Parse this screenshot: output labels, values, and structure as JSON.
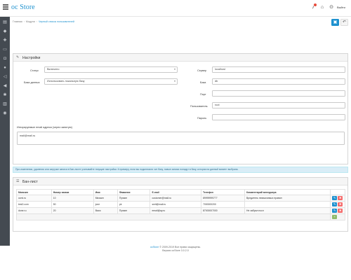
{
  "header": {
    "logo": "oc Store",
    "alert_icon": "bell-icon",
    "home_icon": "home-icon",
    "help_icon": "help-icon",
    "logout": "Выйти"
  },
  "sidebar": {
    "items": [
      "dashboard-icon",
      "tag-icon",
      "puzzle-icon",
      "tv-icon",
      "cart-icon",
      "user-icon",
      "share-icon",
      "megaphone-icon",
      "gear-icon",
      "chart-icon",
      "circle-icon"
    ]
  },
  "breadcrumb": {
    "home": "Главная",
    "modules": "Модули",
    "current": "Черный список пользователей"
  },
  "toolbar": {
    "save_icon": "save-icon",
    "back_icon": "reply-icon"
  },
  "settings": {
    "title": "Настройки",
    "status_label": "Статус",
    "status_value": "Включено",
    "db_label": "База данных",
    "db_value": "Использовать локальную базу",
    "server_label": "Сервер",
    "server_value": "localhost",
    "db_name_label": "База",
    "db_name_value": "db",
    "port_label": "Порт",
    "port_value": "",
    "user_label": "Пользователь",
    "user_value": "root",
    "password_label": "Пароль",
    "password_value": "",
    "whitelist_label": "Игнорируемые email адреса (через запятую)",
    "whitelist_value": "mail@mail.ru"
  },
  "info_alert": "При изменении, удалении или загрузке записи в Бан-листе учитывайте текущие настройки. К примеру, если вы подключили чит базу, новые записи попадут в базу, которая на данный момент выбрана.",
  "blacklist": {
    "title": "Бан-лист",
    "columns": [
      "Магазин",
      "Номер заказа",
      "Имя",
      "Фамилия",
      "E-mail",
      "Телефон",
      "Комментарий менеджера",
      ""
    ],
    "rows": [
      [
        "ocmi.ru",
        "10",
        "Михаил",
        "Пупкин",
        "customer@mail.ru",
        "89999999777",
        "Вредитель немыслимых правил"
      ],
      [
        "test2.com",
        "50",
        "jone",
        "pk",
        "smit@mail.ru",
        "7000000200",
        ""
      ],
      [
        "done.ru",
        "20",
        "Вася",
        "Пупкин",
        "email@ay.ru",
        "87000007000",
        "Не забрал посл"
      ]
    ]
  },
  "footer": {
    "brand": "ocStore",
    "copyright": "© 2009-2019 Все права защищены.",
    "version": "Версия ocStore 3.0.2.0"
  },
  "colors": {
    "accent": "#1e91cf",
    "sidebar": "#444a51",
    "danger": "#f56b6b",
    "success": "#8fbb6c",
    "info_bg": "#d9edf7"
  }
}
